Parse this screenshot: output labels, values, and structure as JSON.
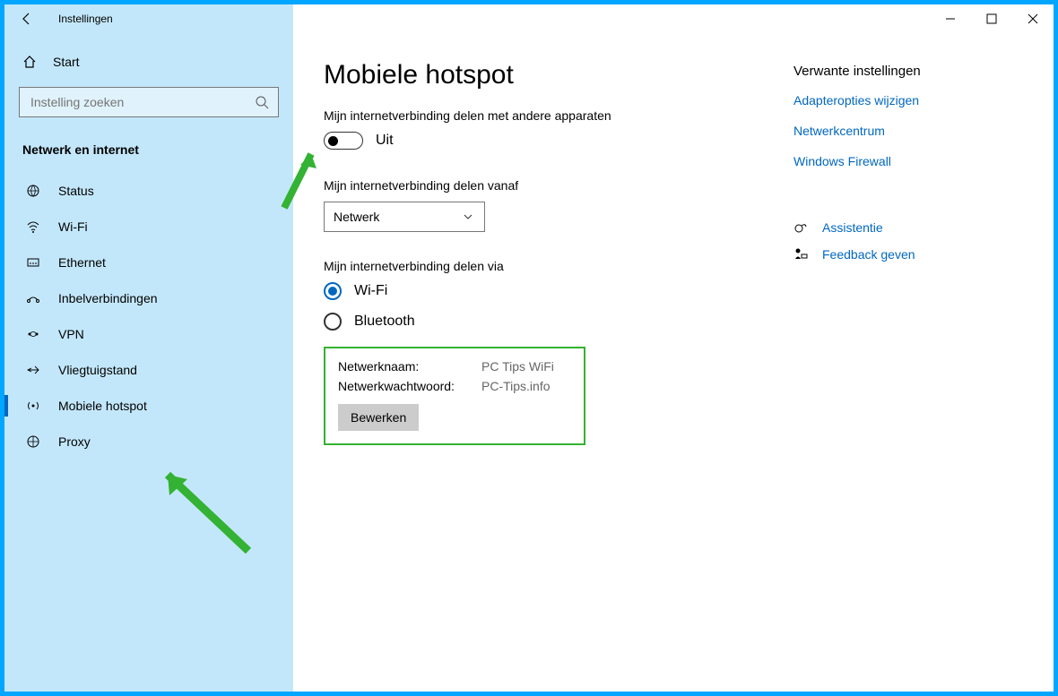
{
  "window": {
    "title": "Instellingen"
  },
  "sidebar": {
    "home": "Start",
    "search_placeholder": "Instelling zoeken",
    "section": "Netwerk en internet",
    "items": [
      {
        "label": "Status"
      },
      {
        "label": "Wi-Fi"
      },
      {
        "label": "Ethernet"
      },
      {
        "label": "Inbelverbindingen"
      },
      {
        "label": "VPN"
      },
      {
        "label": "Vliegtuigstand"
      },
      {
        "label": "Mobiele hotspot"
      },
      {
        "label": "Proxy"
      }
    ]
  },
  "page": {
    "title": "Mobiele hotspot",
    "share_label": "Mijn internetverbinding delen met andere apparaten",
    "toggle_state": "Uit",
    "share_from_label": "Mijn internetverbinding delen vanaf",
    "share_from_value": "Netwerk",
    "share_via_label": "Mijn internetverbinding delen via",
    "radio_wifi": "Wi-Fi",
    "radio_bt": "Bluetooth",
    "network_name_label": "Netwerknaam:",
    "network_name_value": "PC Tips WiFi",
    "network_pw_label": "Netwerkwachtwoord:",
    "network_pw_value": "PC-Tips.info",
    "edit_button": "Bewerken"
  },
  "related": {
    "heading": "Verwante instellingen",
    "links": [
      "Adapteropties wijzigen",
      "Netwerkcentrum",
      "Windows Firewall"
    ],
    "help": "Assistentie",
    "feedback": "Feedback geven"
  }
}
